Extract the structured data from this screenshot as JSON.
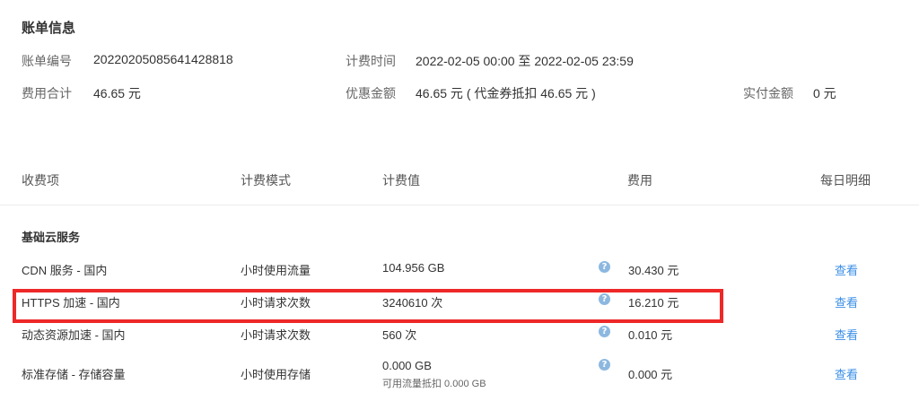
{
  "bill_info": {
    "title": "账单信息",
    "bill_no_label": "账单编号",
    "bill_no": "20220205085641428818",
    "billing_time_label": "计费时间",
    "billing_time": "2022-02-05 00:00 至 2022-02-05 23:59",
    "total_label": "费用合计",
    "total": "46.65 元",
    "discount_label": "优惠金额",
    "discount": "46.65 元 ( 代金券抵扣 46.65 元 )",
    "paid_label": "实付金额",
    "paid": "0 元"
  },
  "table": {
    "headers": [
      "收费项",
      "计费模式",
      "计费值",
      "费用",
      "每日明细"
    ],
    "group_title": "基础云服务",
    "rows": [
      {
        "item": "CDN 服务 - 国内",
        "mode": "小时使用流量",
        "value": "104.956 GB",
        "note": "",
        "fee": "30.430 元",
        "action": "查看"
      },
      {
        "item": "HTTPS 加速 - 国内",
        "mode": "小时请求次数",
        "value": "3240610 次",
        "note": "",
        "fee": "16.210 元",
        "action": "查看"
      },
      {
        "item": "动态资源加速 - 国内",
        "mode": "小时请求次数",
        "value": "560 次",
        "note": "",
        "fee": "0.010 元",
        "action": "查看"
      },
      {
        "item": "标准存储 - 存储容量",
        "mode": "小时使用存储",
        "value": "0.000 GB",
        "note": "可用流量抵扣 0.000 GB",
        "fee": "0.000 元",
        "action": "查看"
      }
    ]
  },
  "colors": {
    "link": "#3a8ee6",
    "highlight": "#ee2828",
    "help_icon": "#8cb8e0"
  },
  "icons": {
    "help": "question-circle-icon"
  }
}
